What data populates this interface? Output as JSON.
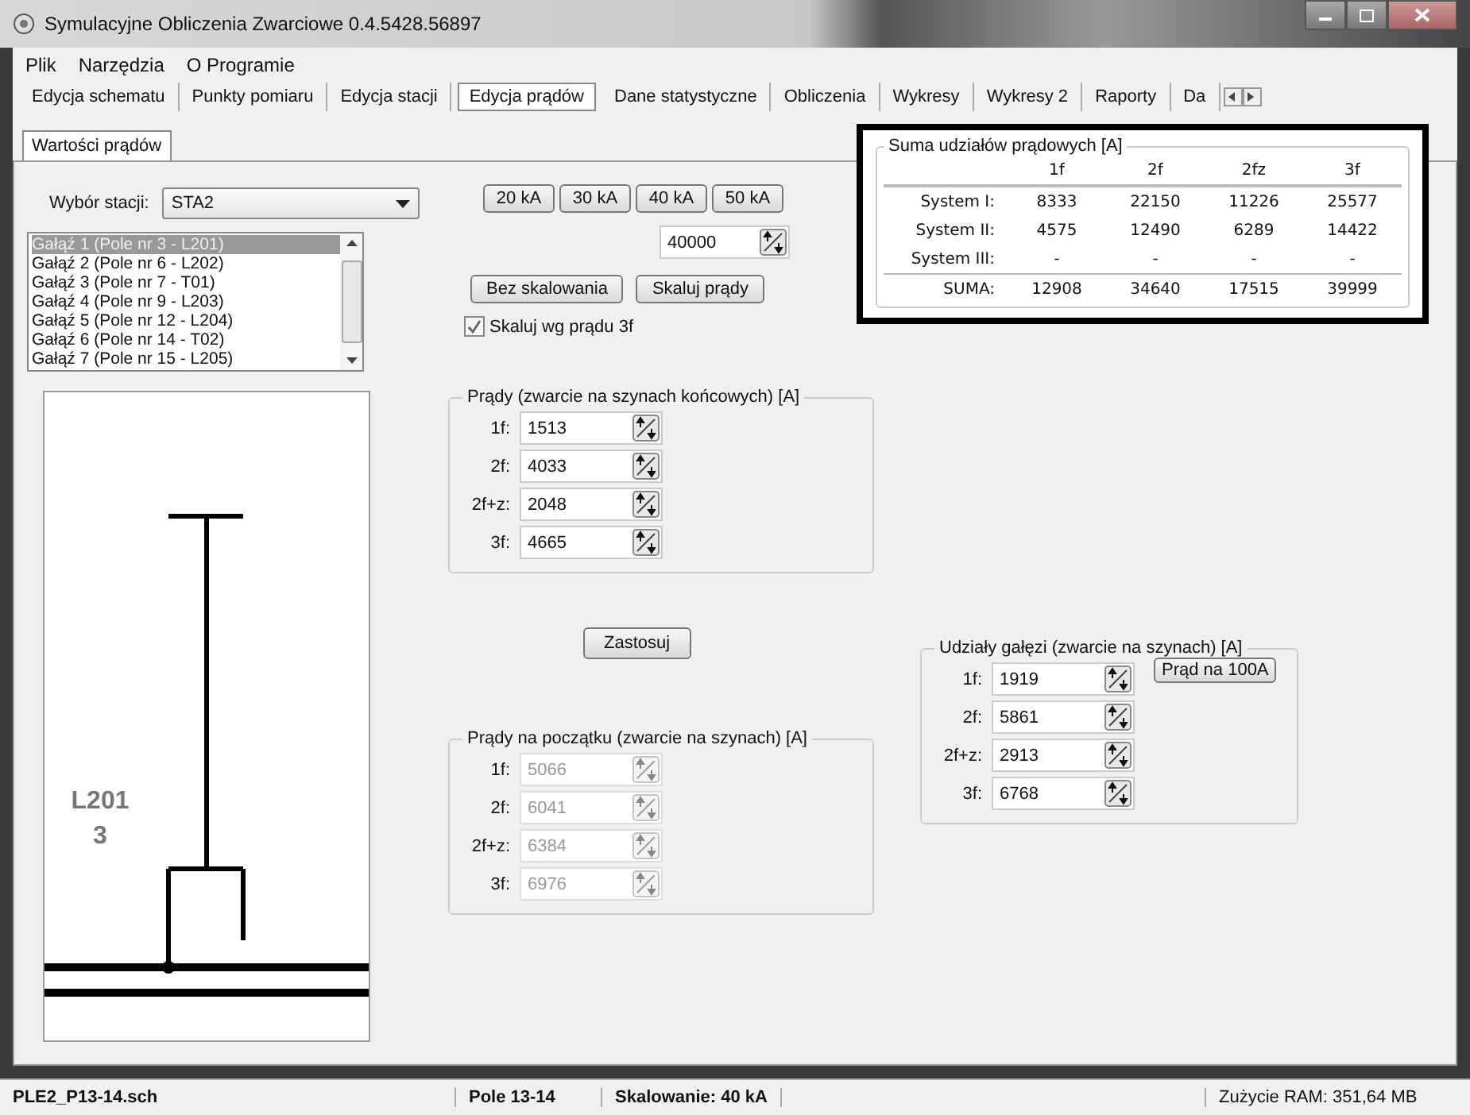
{
  "window": {
    "title": "Symulacyjne Obliczenia Zwarciowe 0.4.5428.56897"
  },
  "menu": [
    "Plik",
    "Narzędzia",
    "O Programie"
  ],
  "tabs": [
    {
      "label": "Edycja schematu",
      "selected": false
    },
    {
      "label": "Punkty pomiaru",
      "selected": false
    },
    {
      "label": "Edycja stacji",
      "selected": false
    },
    {
      "label": "Edycja prądów",
      "selected": true
    },
    {
      "label": "Dane statystyczne",
      "selected": false
    },
    {
      "label": "Obliczenia",
      "selected": false
    },
    {
      "label": "Wykresy",
      "selected": false
    },
    {
      "label": "Wykresy 2",
      "selected": false
    },
    {
      "label": "Raporty",
      "selected": false
    },
    {
      "label": "Da",
      "selected": false
    }
  ],
  "subtabs": [
    {
      "label": "Wartości prądów",
      "selected": true
    }
  ],
  "station": {
    "label": "Wybór stacji:",
    "value": "STA2"
  },
  "branches": [
    {
      "label": "Gałąź 1 (Pole nr 3 - L201)",
      "selected": true
    },
    {
      "label": "Gałąź 2 (Pole nr 6 - L202)",
      "selected": false
    },
    {
      "label": "Gałąź 3 (Pole nr 7 - T01)",
      "selected": false
    },
    {
      "label": "Gałąź 4 (Pole nr 9 - L203)",
      "selected": false
    },
    {
      "label": "Gałąź 5 (Pole nr 12 - L204)",
      "selected": false
    },
    {
      "label": "Gałąź 6 (Pole nr 14 - T02)",
      "selected": false
    },
    {
      "label": "Gałąź 7 (Pole nr 15 - L205)",
      "selected": false
    }
  ],
  "scale_buttons": [
    "20 kA",
    "30 kA",
    "40 kA",
    "50 kA"
  ],
  "scale_value": "40000",
  "scale_actions": [
    "Bez skalowania",
    "Skaluj prądy"
  ],
  "scale_by_3f": {
    "label": "Skaluj wg prądu 3f",
    "checked": true
  },
  "diagram": {
    "labels": [
      "L201",
      "3"
    ]
  },
  "end_currents": {
    "title": "Prądy (zwarcie na szynach końcowych) [A]",
    "disabled": false,
    "rows": [
      {
        "label": "1f:",
        "value": "1513"
      },
      {
        "label": "2f:",
        "value": "4033"
      },
      {
        "label": "2f+z:",
        "value": "2048"
      },
      {
        "label": "3f:",
        "value": "4665"
      }
    ]
  },
  "apply_button": "Zastosuj",
  "start_currents": {
    "title": "Prądy na początku (zwarcie na szynach) [A]",
    "disabled": true,
    "rows": [
      {
        "label": "1f:",
        "value": "5066"
      },
      {
        "label": "2f:",
        "value": "6041"
      },
      {
        "label": "2f+z:",
        "value": "6384"
      },
      {
        "label": "3f:",
        "value": "6976"
      }
    ]
  },
  "summary": {
    "title": "Suma udziałów prądowych [A]",
    "columns": [
      "1f",
      "2f",
      "2fz",
      "3f"
    ],
    "rows": [
      {
        "label": "System I:",
        "values": [
          "8333",
          "22150",
          "11226",
          "25577"
        ]
      },
      {
        "label": "System II:",
        "values": [
          "4575",
          "12490",
          "6289",
          "14422"
        ]
      },
      {
        "label": "System III:",
        "values": [
          "-",
          "-",
          "-",
          "-"
        ]
      }
    ],
    "total": {
      "label": "SUMA:",
      "values": [
        "12908",
        "34640",
        "17515",
        "39999"
      ]
    }
  },
  "branch_shares": {
    "title": "Udziały gałęzi (zwarcie na szynach) [A]",
    "disabled": false,
    "button": "Prąd na 100A",
    "rows": [
      {
        "label": "1f:",
        "value": "1919"
      },
      {
        "label": "2f:",
        "value": "5861"
      },
      {
        "label": "2f+z:",
        "value": "2913"
      },
      {
        "label": "3f:",
        "value": "6768"
      }
    ]
  },
  "status_bar": {
    "panels": [
      "PLE2_P13-14.sch",
      "Pole 13-14",
      "Skalowanie: 40 kA"
    ],
    "ram": "Zużycie RAM: 351,64 MB"
  }
}
